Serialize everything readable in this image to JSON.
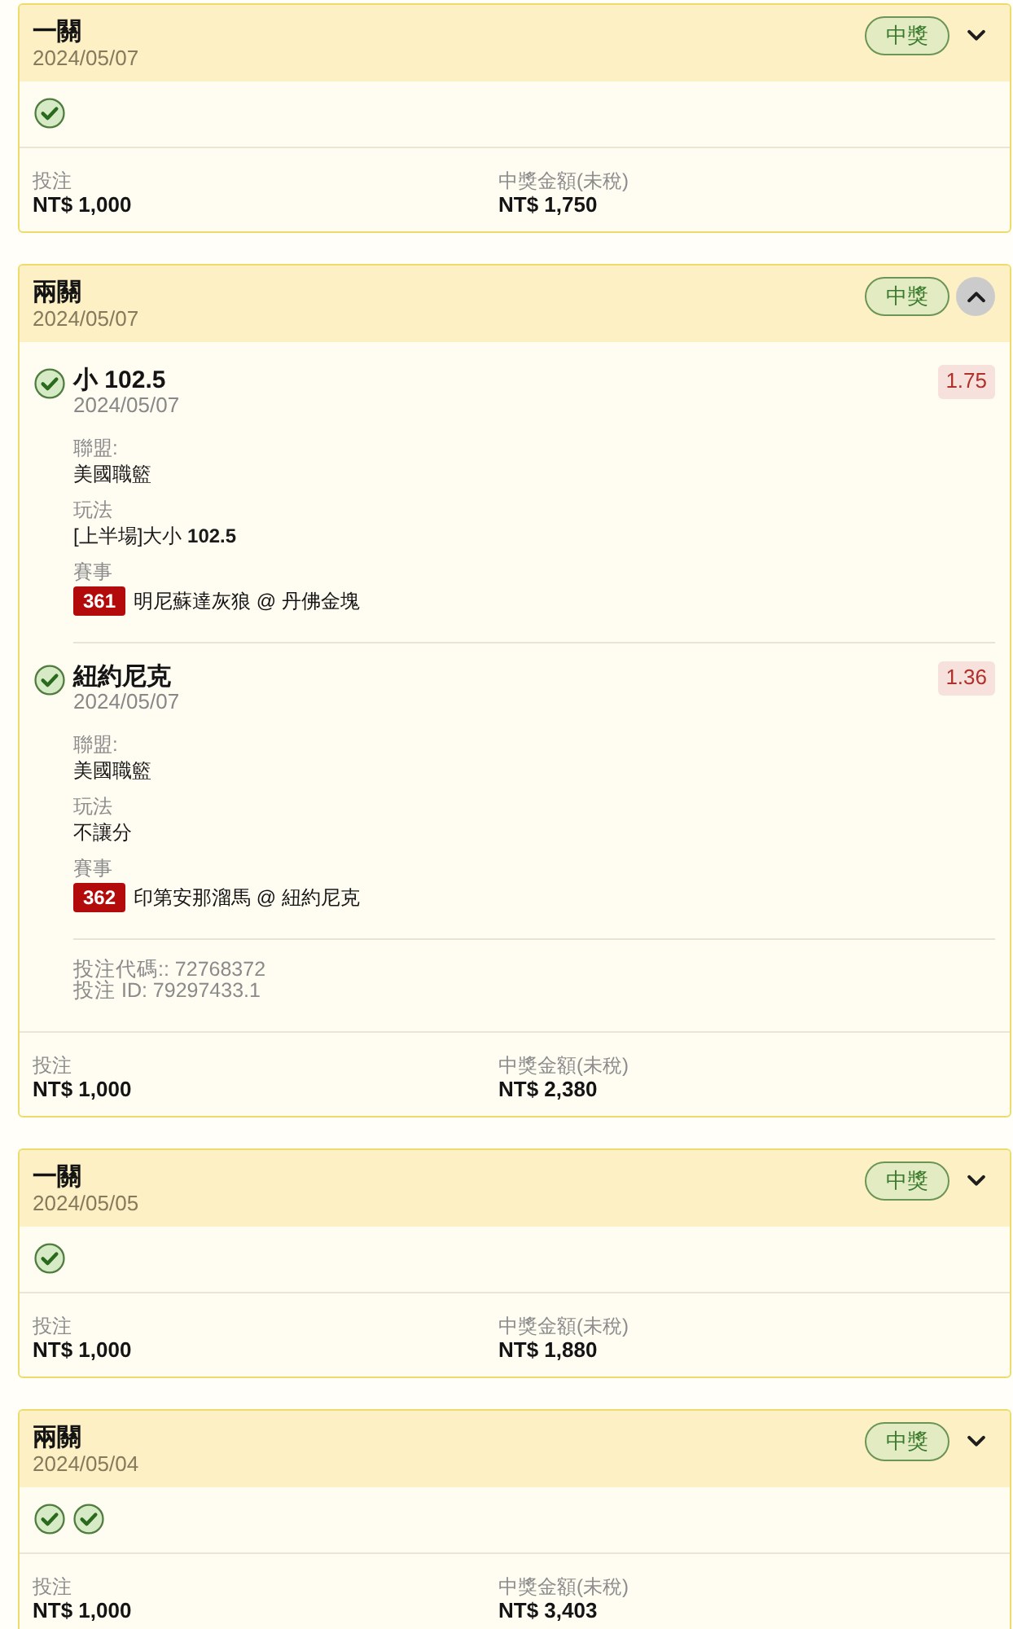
{
  "bets": [
    {
      "title": "一關",
      "date": "2024/05/07",
      "status": "中獎",
      "expanded": false,
      "legs": [
        {
          "won": true
        }
      ],
      "stake_label": "投注",
      "stake": "NT$ 1,000",
      "payout_label": "中獎金額(未稅)",
      "payout": "NT$ 1,750"
    },
    {
      "title": "兩關",
      "date": "2024/05/07",
      "status": "中獎",
      "expanded": true,
      "legs": [
        {
          "won": true,
          "selection": "小 102.5",
          "date": "2024/05/07",
          "odds": "1.75",
          "fields": [
            {
              "kind": "text",
              "label": "聯盟:",
              "value": "美國職籃"
            },
            {
              "kind": "text",
              "label": "玩法",
              "value": "[上半場]大小 **102.5**"
            },
            {
              "kind": "match",
              "label": "賽事",
              "number": "361",
              "value": "明尼蘇達灰狼 @ 丹佛金塊"
            }
          ]
        },
        {
          "won": true,
          "selection": "紐約尼克",
          "date": "2024/05/07",
          "odds": "1.36",
          "fields": [
            {
              "kind": "text",
              "label": "聯盟:",
              "value": "美國職籃"
            },
            {
              "kind": "text",
              "label": "玩法",
              "value": "不讓分"
            },
            {
              "kind": "match",
              "label": "賽事",
              "number": "362",
              "value": "印第安那溜馬 @ 紐約尼克"
            }
          ]
        }
      ],
      "details": [
        "投注代碼:: 72768372",
        "投注 ID: 79297433.1"
      ],
      "stake_label": "投注",
      "stake": "NT$ 1,000",
      "payout_label": "中獎金額(未稅)",
      "payout": "NT$ 2,380"
    },
    {
      "title": "一關",
      "date": "2024/05/05",
      "status": "中獎",
      "expanded": false,
      "legs": [
        {
          "won": true
        }
      ],
      "stake_label": "投注",
      "stake": "NT$ 1,000",
      "payout_label": "中獎金額(未稅)",
      "payout": "NT$ 1,880"
    },
    {
      "title": "兩關",
      "date": "2024/05/04",
      "status": "中獎",
      "expanded": false,
      "legs": [
        {
          "won": true
        },
        {
          "won": true
        }
      ],
      "stake_label": "投注",
      "stake": "NT$ 1,000",
      "payout_label": "中獎金額(未稅)",
      "payout": "NT$ 3,403"
    }
  ]
}
